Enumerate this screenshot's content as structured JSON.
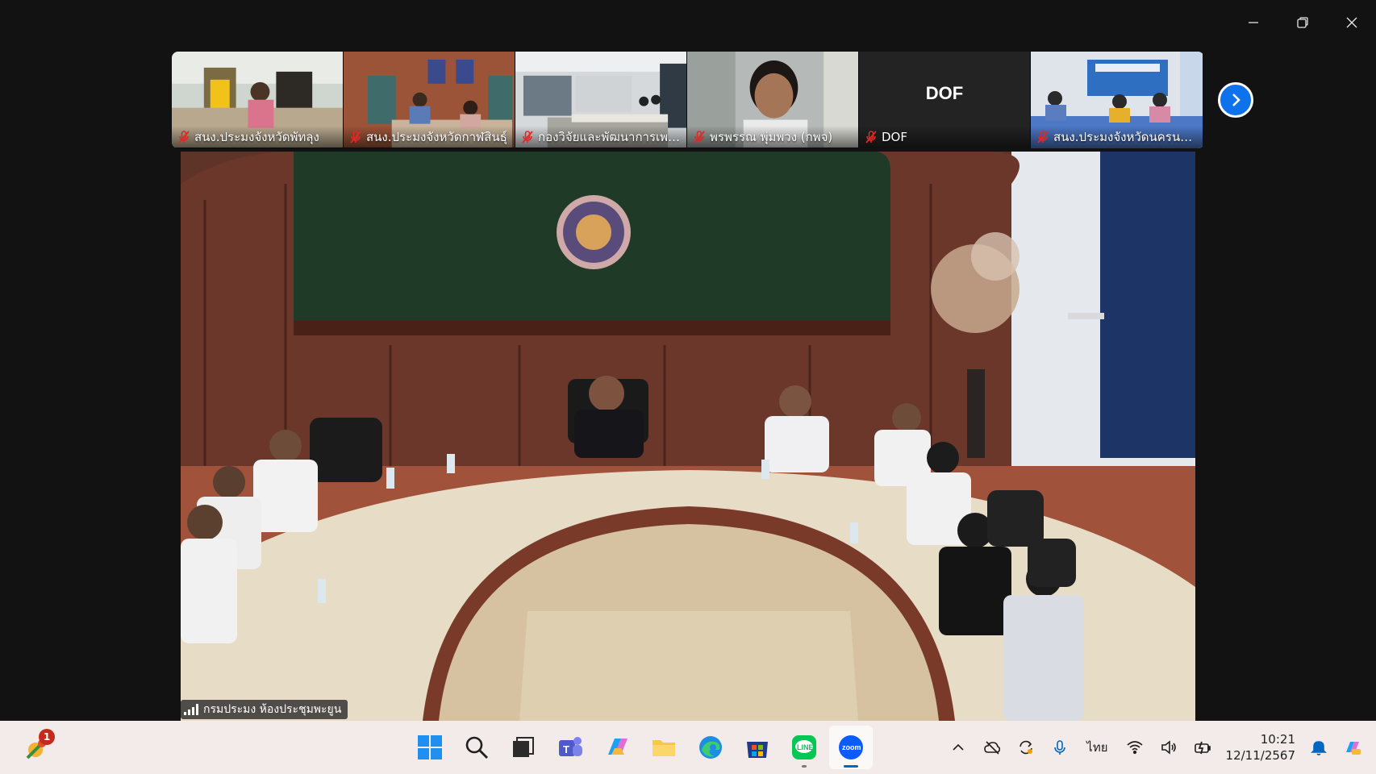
{
  "window": {
    "controls": [
      "minimize",
      "restore",
      "close"
    ]
  },
  "participants": [
    {
      "name": "สนง.ประมงจังหวัดพัทลุง",
      "muted": true
    },
    {
      "name": "สนง.ประมงจังหวัดกาฬสินธุ์",
      "muted": true
    },
    {
      "name": "กองวิจัยและพัฒนาการเพา...",
      "muted": true
    },
    {
      "name": "พรพรรณ พุ่มพวง (กพจ)",
      "muted": true
    },
    {
      "name": "DOF",
      "muted": true,
      "avatar_text": "DOF"
    },
    {
      "name": "สนง.ประมงจังหวัดนครนายก",
      "muted": true
    }
  ],
  "main_video": {
    "speaker_name": "กรมประมง ห้องประชุมพะยูน"
  },
  "taskbar": {
    "notification_badge": "1",
    "apps": [
      {
        "name": "start",
        "active": false,
        "running": false
      },
      {
        "name": "search",
        "active": false,
        "running": false
      },
      {
        "name": "task-view",
        "active": false,
        "running": false
      },
      {
        "name": "teams",
        "active": false,
        "running": false
      },
      {
        "name": "copilot",
        "active": false,
        "running": false
      },
      {
        "name": "file-explorer",
        "active": false,
        "running": false
      },
      {
        "name": "edge",
        "active": false,
        "running": false
      },
      {
        "name": "store",
        "active": false,
        "running": false
      },
      {
        "name": "line",
        "active": false,
        "running": true
      },
      {
        "name": "zoom",
        "active": true,
        "running": true
      }
    ],
    "language": "ไทย",
    "time": "10:21",
    "date": "12/11/2567"
  },
  "colors": {
    "accent": "#0e72ed",
    "mute_red": "#e02828",
    "taskbar_bg": "#f3eaea"
  }
}
